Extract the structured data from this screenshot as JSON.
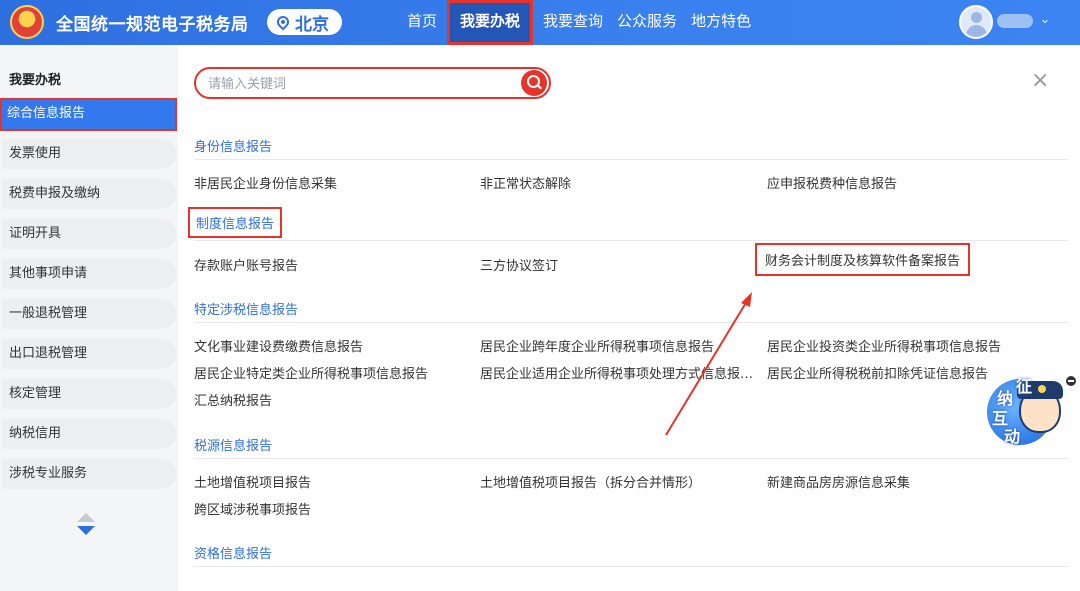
{
  "header": {
    "app_title": "全国统一规范电子税务局",
    "location": "北京",
    "nav": [
      "首页",
      "我要办税",
      "我要查询",
      "公众服务",
      "地方特色"
    ],
    "active_nav": "我要办税"
  },
  "sidebar": {
    "title": "我要办税",
    "items": [
      {
        "label": "综合信息报告",
        "active": true
      },
      {
        "label": "发票使用"
      },
      {
        "label": "税费申报及缴纳"
      },
      {
        "label": "证明开具"
      },
      {
        "label": "其他事项申请"
      },
      {
        "label": "一般退税管理"
      },
      {
        "label": "出口退税管理"
      },
      {
        "label": "核定管理"
      },
      {
        "label": "纳税信用"
      },
      {
        "label": "涉税专业服务"
      }
    ]
  },
  "search": {
    "placeholder": "请输入关键词",
    "value": ""
  },
  "close_label": "×",
  "sections": [
    {
      "title": "身份信息报告",
      "items": [
        "非居民企业身份信息采集",
        "非正常状态解除",
        "应申报税费种信息报告"
      ]
    },
    {
      "title": "制度信息报告",
      "highlighted": true,
      "items": [
        "存款账户账号报告",
        "三方协议签订",
        "财务会计制度及核算软件备案报告"
      ],
      "highlighted_item": "财务会计制度及核算软件备案报告"
    },
    {
      "title": "特定涉税信息报告",
      "items": [
        "文化事业建设费缴费信息报告",
        "居民企业跨年度企业所得税事项信息报告",
        "居民企业投资类企业所得税事项信息报告",
        "居民企业特定类企业所得税事项信息报告",
        "居民企业适用企业所得税事项处理方式信息报…",
        "居民企业所得税税前扣除凭证信息报告",
        "汇总纳税报告"
      ]
    },
    {
      "title": "税源信息报告",
      "items": [
        "土地增值税项目报告",
        "土地增值税项目报告（拆分合并情形）",
        "新建商品房房源信息采集",
        "跨区域涉税事项报告"
      ]
    },
    {
      "title": "资格信息报告",
      "items": []
    }
  ],
  "mascot": {
    "chars": [
      "征",
      "纳",
      "互",
      "动"
    ]
  },
  "colors": {
    "primary": "#2e6fe0",
    "highlight_red": "#e5342c",
    "sidebar_bg": "#f4f5f7"
  }
}
